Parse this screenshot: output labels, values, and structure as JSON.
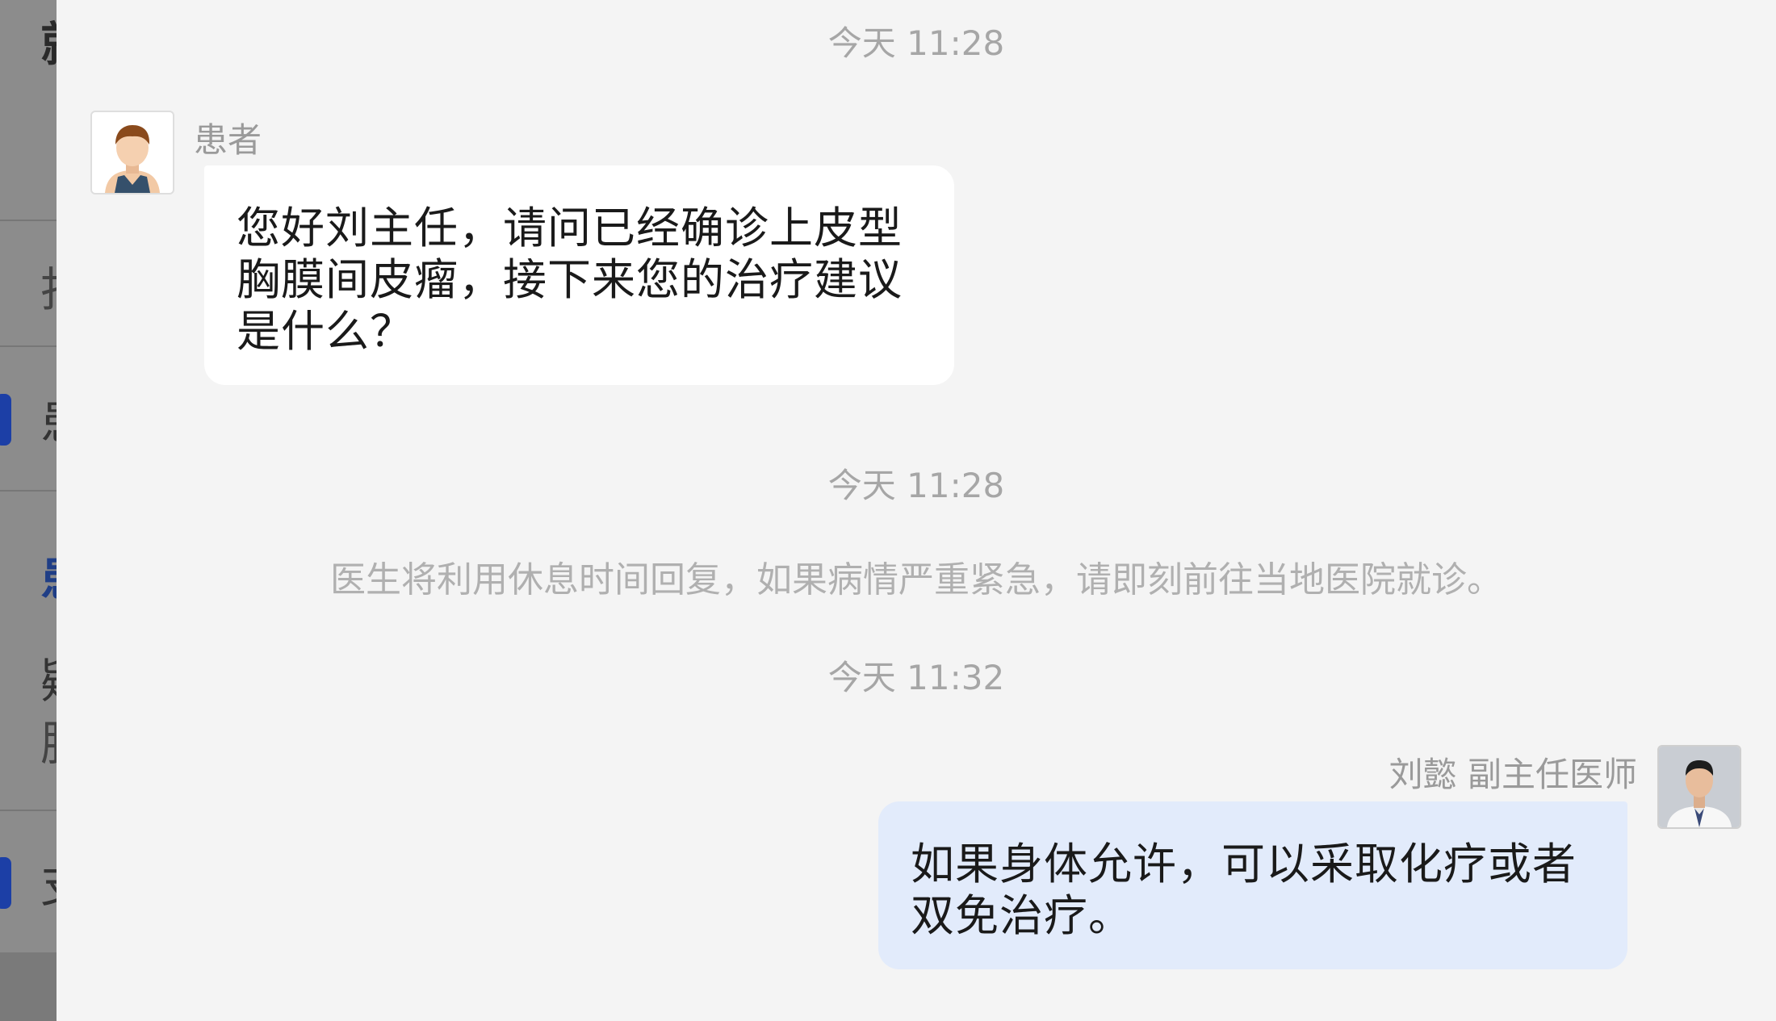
{
  "background_panel": {
    "fragments": [
      "就",
      "找",
      "患",
      "患",
      "疑",
      "肺",
      "支"
    ]
  },
  "chat": {
    "timestamp_1": "今天 11:28",
    "patient_message": {
      "sender": "患者",
      "lines": [
        "您好刘主任，请问已经确诊上皮型",
        "胸膜间皮瘤，接下来您的治疗建议",
        "是什么？"
      ]
    },
    "timestamp_2": "今天 11:28",
    "system_note": "医生将利用休息时间回复，如果病情严重紧急，请即刻前往当地医院就诊。",
    "timestamp_3": "今天 11:32",
    "doctor_message": {
      "sender": "刘懿 副主任医师",
      "lines": [
        "如果身体允许，可以采取化疗或者",
        "双免治疗。"
      ]
    }
  },
  "colors": {
    "chat_background": "#f4f4f4",
    "incoming_bubble": "#ffffff",
    "outgoing_bubble": "#e2ebfb",
    "muted_text": "#a6a6a6",
    "overlay_panel": "#8c8c8c",
    "accent_marker": "#1c3fa6"
  },
  "icons": {
    "patient_avatar": "patient-avatar-icon",
    "doctor_avatar": "doctor-avatar-photo"
  }
}
